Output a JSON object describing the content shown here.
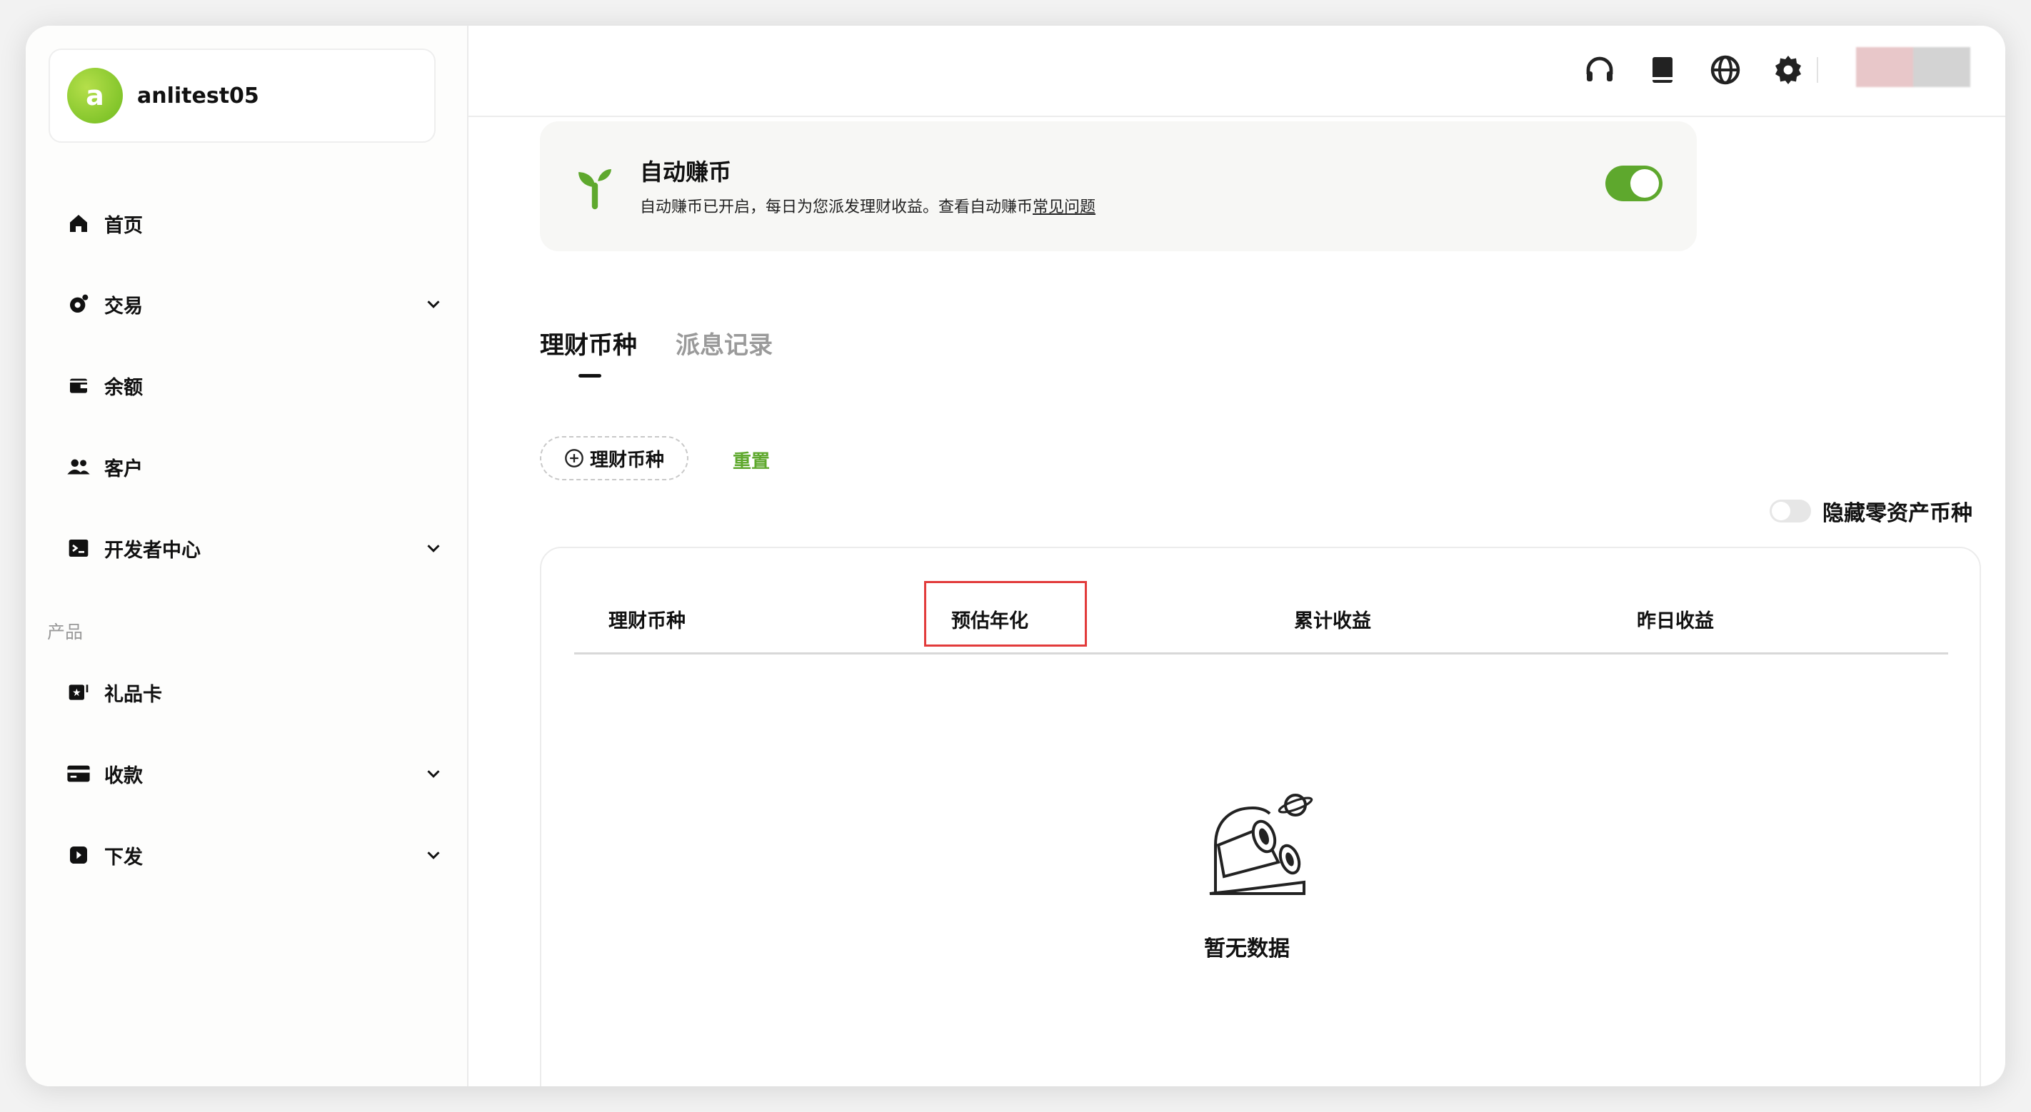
{
  "user": {
    "avatar_letter": "a",
    "name": "anlitest05"
  },
  "sidebar": {
    "items": [
      {
        "label": "首页",
        "icon": "home-icon",
        "has_chevron": false
      },
      {
        "label": "交易",
        "icon": "transaction-icon",
        "has_chevron": true
      },
      {
        "label": "余额",
        "icon": "wallet-icon",
        "has_chevron": false
      },
      {
        "label": "客户",
        "icon": "customers-icon",
        "has_chevron": false
      },
      {
        "label": "开发者中心",
        "icon": "terminal-icon",
        "has_chevron": true
      }
    ],
    "section_label": "产品",
    "product_items": [
      {
        "label": "礼品卡",
        "icon": "gift-card-icon",
        "has_chevron": false
      },
      {
        "label": "收款",
        "icon": "card-icon",
        "has_chevron": true
      },
      {
        "label": "下发",
        "icon": "payout-icon",
        "has_chevron": true
      }
    ]
  },
  "topbar": {
    "icons": [
      "headset-icon",
      "book-icon",
      "globe-icon",
      "gear-icon"
    ]
  },
  "banner": {
    "icon": "sprout-icon",
    "title": "自动赚币",
    "desc": "自动赚币已开启，每日为您派发理财收益。查看自动赚币",
    "link": "常见问题",
    "toggle_on": true
  },
  "tabs": [
    {
      "label": "理财币种",
      "active": true
    },
    {
      "label": "派息记录",
      "active": false
    }
  ],
  "filters": {
    "chip_label": "理财币种",
    "reset_label": "重置",
    "hide_zero_label": "隐藏零资产币种",
    "hide_zero_on": false
  },
  "table": {
    "columns": [
      "理财币种",
      "预估年化",
      "累计收益",
      "昨日收益"
    ],
    "rows": [],
    "empty_text": "暂无数据"
  },
  "colors": {
    "accent": "#5ea82d",
    "highlight": "#e23b3b"
  }
}
